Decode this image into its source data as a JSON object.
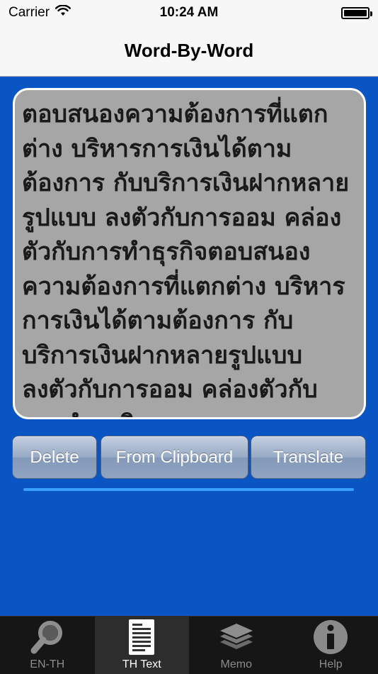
{
  "status_bar": {
    "carrier": "Carrier",
    "time": "10:24 AM",
    "battery_level": 1.0
  },
  "nav": {
    "title": "Word-By-Word"
  },
  "text_area": {
    "content": "ตอบสนองความต้องการที่แตกต่าง บริหารการเงินได้ตามต้องการ กับบริการเงินฝากหลายรูปแบบ ลงตัวกับการออม คล่องตัวกับการทำธุรกิจตอบสนองความต้องการที่แตกต่าง บริหารการเงินได้ตามต้องการ กับบริการเงินฝากหลายรูปแบบ ลงตัวกับการออม คล่องตัวกับการทำธุรกิจ"
  },
  "buttons": {
    "delete_label": "Delete",
    "clipboard_label": "From Clipboard",
    "translate_label": "Translate"
  },
  "progress": {
    "value": 1.0
  },
  "tabs": [
    {
      "label": "EN-TH",
      "icon": "magnifier-icon",
      "selected": false
    },
    {
      "label": "TH Text",
      "icon": "document-icon",
      "selected": true
    },
    {
      "label": "Memo",
      "icon": "layers-icon",
      "selected": false
    },
    {
      "label": "Help",
      "icon": "info-icon",
      "selected": false
    }
  ],
  "colors": {
    "background": "#0a55c4",
    "text_area_bg": "#a6a6a6",
    "progress": "#3aa0ff",
    "tab_bar": "#161616"
  }
}
